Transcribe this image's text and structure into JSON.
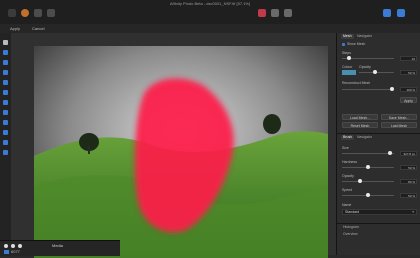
{
  "window": {
    "title": "Affinity Photo Beta - dsc0001_NSF.tif [57.1%]"
  },
  "toolbar": {
    "apply_label": "Apply",
    "cancel_label": "Cancel"
  },
  "panel": {
    "tabs": [
      "Mesh",
      "Navigator"
    ],
    "show_mesh_label": "Show Mesh",
    "steps_label": "Steps",
    "steps_value": "10",
    "colour_label": "Colour",
    "opacity_label": "Opacity",
    "opacity_value": "50 %",
    "reconstruct_label": "Reconstruct Mesh",
    "reconstruct_value": "100 %",
    "apply_button": "Apply",
    "load_mesh": "Load Mesh...",
    "save_mesh": "Save Mesh...",
    "reset_mesh": "Reset Mesh",
    "last_mesh": "Last Mesh"
  },
  "brush": {
    "tabs": [
      "Brush",
      "Navigator"
    ],
    "size_label": "Size",
    "size_value": "327.8 px",
    "hardness_label": "Hardness",
    "hardness_value": "50 %",
    "opacity_label": "Opacity",
    "opacity_value": "80 %",
    "speed_label": "Speed",
    "speed_value": "50 %",
    "name_label": "Name",
    "name_value": "Standard"
  },
  "bottom_right": {
    "tabs": [
      "Histogram",
      "Overview"
    ]
  },
  "media": {
    "title": "Media",
    "folder": "6077"
  },
  "colors": {
    "mask": "#ff1a4a",
    "accent": "#3a7bd5",
    "swatch": "#4a8fb0"
  }
}
